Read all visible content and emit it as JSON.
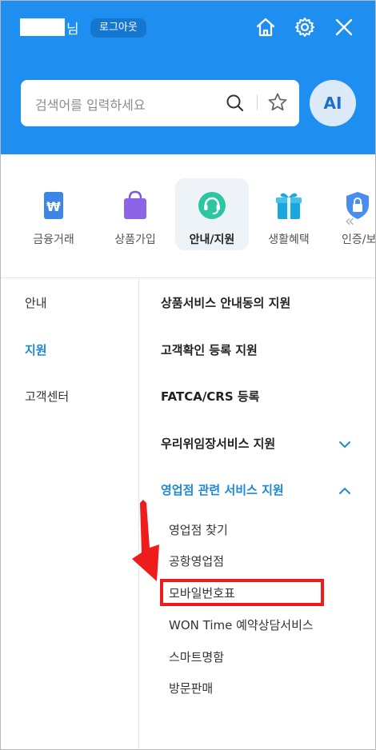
{
  "header": {
    "user_suffix": "님",
    "logout_label": "로그아웃",
    "home_icon": "home-icon",
    "settings_icon": "gear-icon",
    "close_icon": "close-icon",
    "bg_color": "#1e8ef0"
  },
  "search": {
    "placeholder": "검색어를 입력하세요",
    "ai_label": "AI"
  },
  "categories": [
    {
      "label": "금융거래",
      "icon": "wallet-icon"
    },
    {
      "label": "상품가입",
      "icon": "shopping-bag-icon"
    },
    {
      "label": "안내/지원",
      "icon": "headset-icon",
      "active": true
    },
    {
      "label": "생활혜택",
      "icon": "gift-icon"
    },
    {
      "label": "인증/보",
      "icon": "shield-lock-icon"
    }
  ],
  "left_nav": [
    {
      "label": "안내"
    },
    {
      "label": "지원",
      "active": true
    },
    {
      "label": "고객센터"
    }
  ],
  "right_menu": [
    {
      "label": "상품서비스 안내동의 지원"
    },
    {
      "label": "고객확인 등록 지원"
    },
    {
      "label": "FATCA/CRS 등록"
    },
    {
      "label": "우리위임장서비스 지원"
    },
    {
      "label": "영업점 관련 서비스 지원",
      "expanded": true
    }
  ],
  "sub_menu": [
    {
      "label": "영업점 찾기"
    },
    {
      "label": "공항영업점"
    },
    {
      "label": "모바일번호표",
      "highlighted": true
    },
    {
      "label": "WON Time 예약상담서비스"
    },
    {
      "label": "스마트명함"
    },
    {
      "label": "방문판매"
    }
  ],
  "accent_color": "#1e88d6",
  "annotation_color": "#ee1c1c"
}
